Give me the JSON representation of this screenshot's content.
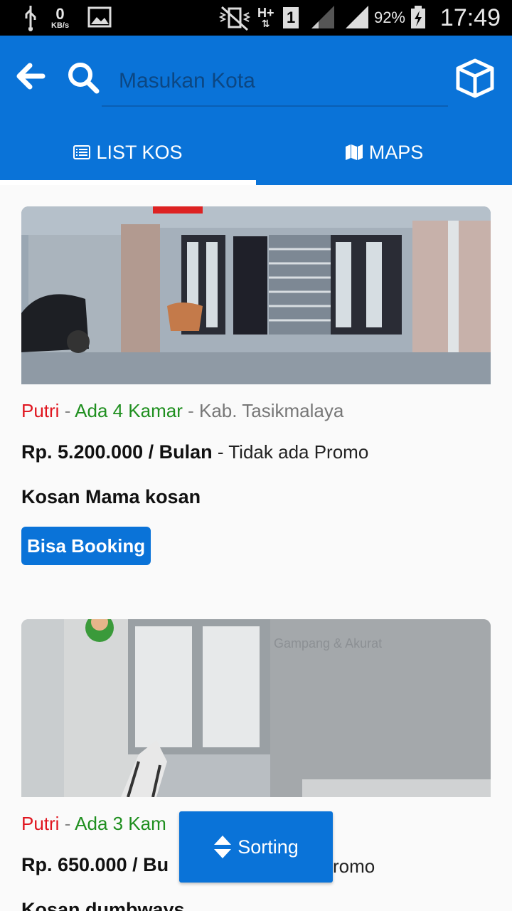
{
  "status_bar": {
    "net_speed_value": "0",
    "net_speed_unit": "KB/s",
    "network_type": "H+",
    "sim_slot": "1",
    "battery_percent": "92%",
    "time": "17:49"
  },
  "app_bar": {
    "search_placeholder": "Masukan Kota",
    "tabs": [
      {
        "label": "LIST KOS",
        "icon": "list-icon",
        "active": true
      },
      {
        "label": "MAPS",
        "icon": "map-icon",
        "active": false
      }
    ]
  },
  "listings": [
    {
      "gender": "Putri",
      "availability": "Ada 4 Kamar",
      "city": "Kab. Tasikmalaya",
      "price": "Rp. 5.200.000 / Bulan",
      "promo": "Tidak ada Promo",
      "name": "Kosan Mama kosan",
      "badge": "Bisa Booking"
    },
    {
      "gender": "Putri",
      "availability": "Ada 3 Kam",
      "price": "Rp. 650.000 / Bu",
      "promo": "romo",
      "name": "Kosan dumbways",
      "photo_watermark": "Gampang & Akurat"
    }
  ],
  "sorting_button": {
    "label": "Sorting",
    "icon": "sort-icon"
  },
  "colors": {
    "primary": "#0a73d8",
    "gender": "#e0151f",
    "availability": "#1f8f1f",
    "status_bar": "#000000"
  }
}
